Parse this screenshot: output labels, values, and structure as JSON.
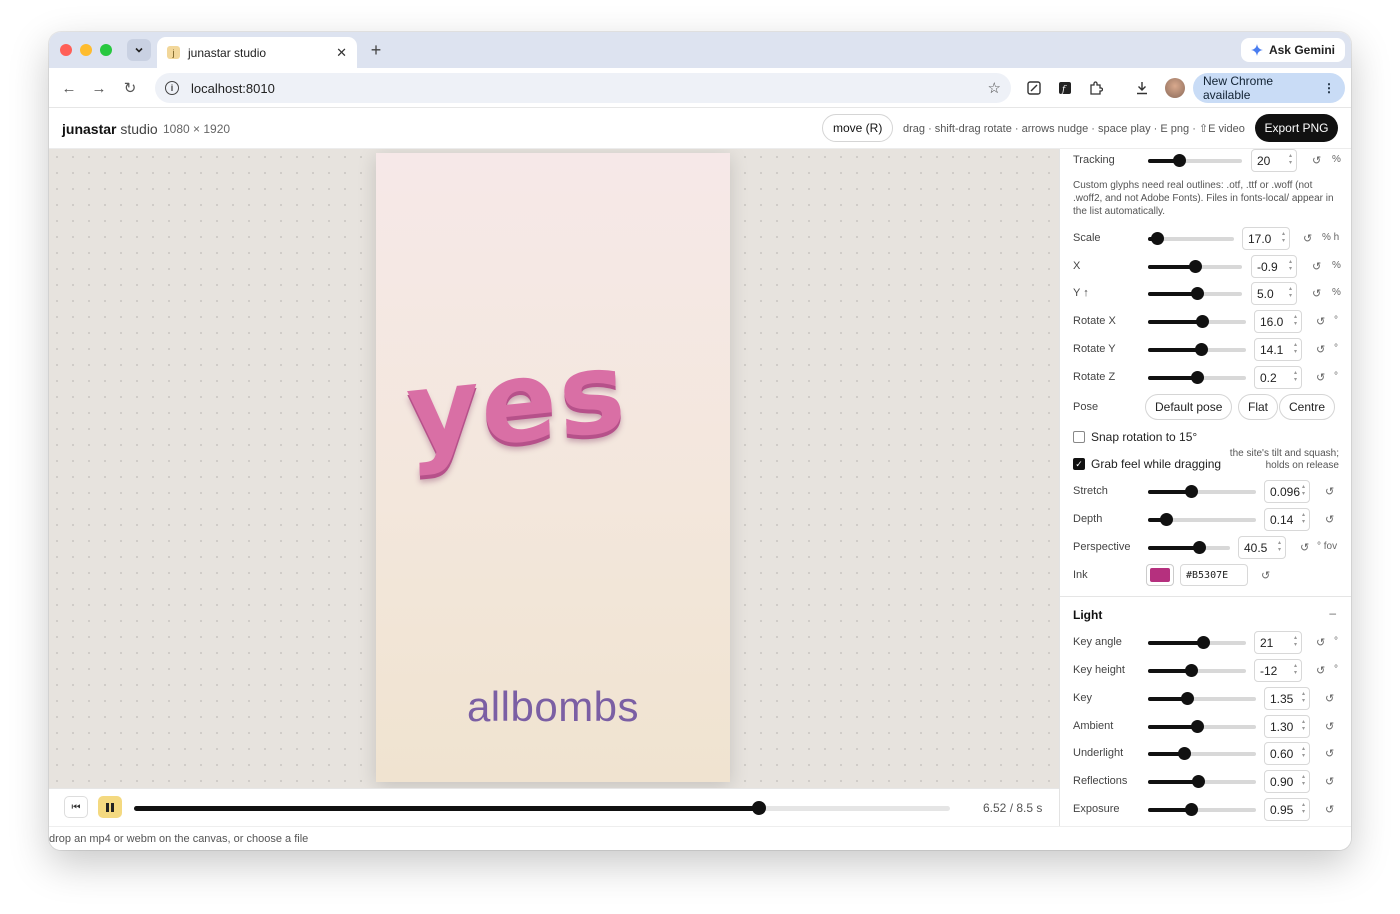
{
  "browser": {
    "tab_title": "junastar studio",
    "tab_favicon": "j",
    "new_tab": "+",
    "ask_gemini": "Ask Gemini",
    "url": "localhost:8010",
    "chrome_update": "New Chrome available"
  },
  "app": {
    "brand_bold": "junastar",
    "brand_rest": " studio",
    "canvas_size": "1080 × 1920",
    "mode_button": "move (R)",
    "hints": "drag · shift-drag rotate · arrows nudge · space play · E png · ⇧E video",
    "export_button": "Export PNG"
  },
  "canvas": {
    "main_text": "yes",
    "sub_text": "allbombs",
    "main_color": "#d96fa5",
    "sub_color": "#7b5fa4"
  },
  "playback": {
    "time": "6.52 / 8.5 s",
    "progress": 0.766
  },
  "status": {
    "text": "drop an mp4 or webm on the canvas, or choose a file"
  },
  "panel": {
    "tracking": {
      "label": "Tracking",
      "value": "20",
      "unit": "%",
      "fraction": 0.33
    },
    "glyph_note": "Custom glyphs need real outlines: .otf, .ttf or .woff (not .woff2, and not Adobe Fonts). Files in fonts-local/ appear in the list automatically.",
    "scale": {
      "label": "Scale",
      "value": "17.0",
      "unit": "% h",
      "fraction": 0.11
    },
    "x": {
      "label": "X",
      "value": "-0.9",
      "unit": "%",
      "fraction": 0.5
    },
    "y": {
      "label": "Y ↑",
      "value": "5.0",
      "unit": "%",
      "fraction": 0.52
    },
    "rotate_x": {
      "label": "Rotate X",
      "value": "16.0",
      "unit": "°",
      "fraction": 0.55
    },
    "rotate_y": {
      "label": "Rotate Y",
      "value": "14.1",
      "unit": "°",
      "fraction": 0.54
    },
    "rotate_z": {
      "label": "Rotate Z",
      "value": "0.2",
      "unit": "°",
      "fraction": 0.5
    },
    "pose": {
      "label": "Pose",
      "buttons": [
        "Default pose",
        "Flat",
        "Centre"
      ]
    },
    "snap_rotation": {
      "label": "Snap rotation to 15°",
      "checked": false
    },
    "grab_feel": {
      "label": "Grab feel while dragging",
      "checked": true,
      "note": "the site's tilt and squash; holds on release"
    },
    "stretch": {
      "label": "Stretch",
      "value": "0.096",
      "fraction": 0.4
    },
    "depth": {
      "label": "Depth",
      "value": "0.14",
      "fraction": 0.17
    },
    "perspective": {
      "label": "Perspective",
      "value": "40.5",
      "unit": "° fov",
      "fraction": 0.62
    },
    "ink": {
      "label": "Ink",
      "value": "#B5307E",
      "color": "#b5307e"
    },
    "light_section": {
      "title": "Light",
      "collapse": "–"
    },
    "key_angle": {
      "label": "Key angle",
      "value": "21",
      "unit": "°",
      "fraction": 0.56
    },
    "key_height": {
      "label": "Key height",
      "value": "-12",
      "unit": "°",
      "fraction": 0.44
    },
    "key": {
      "label": "Key",
      "value": "1.35",
      "fraction": 0.36
    },
    "ambient": {
      "label": "Ambient",
      "value": "1.30",
      "fraction": 0.45
    },
    "underlight": {
      "label": "Underlight",
      "value": "0.60",
      "fraction": 0.33
    },
    "reflections": {
      "label": "Reflections",
      "value": "0.90",
      "fraction": 0.46
    },
    "exposure": {
      "label": "Exposure",
      "value": "0.95",
      "fraction": 0.4
    }
  }
}
